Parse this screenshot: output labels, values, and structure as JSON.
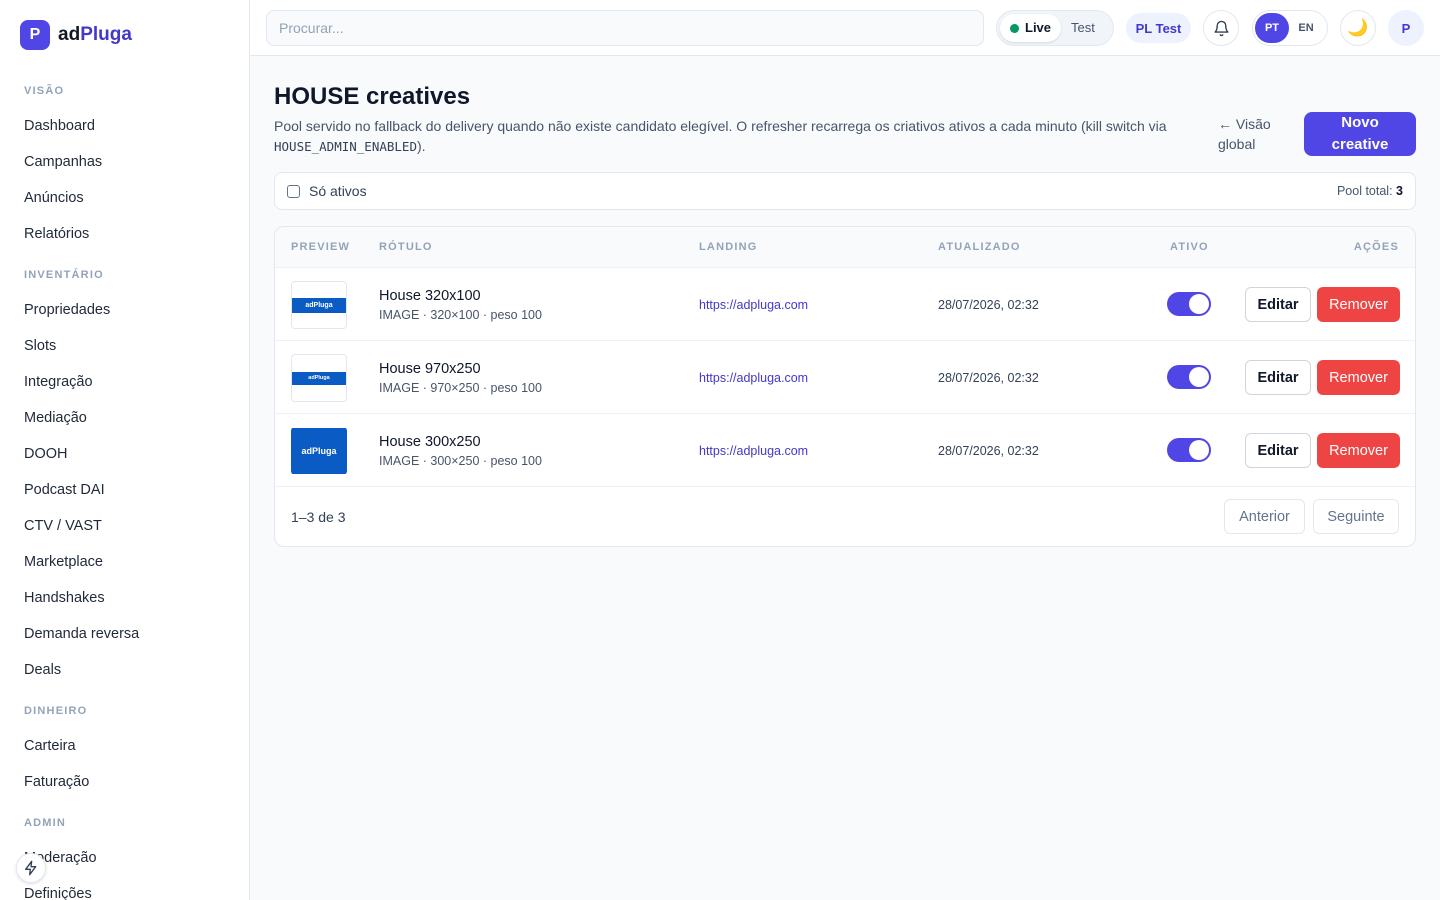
{
  "brand": {
    "logo_letter": "P",
    "name_prefix": "ad",
    "name_suffix": "Pluga"
  },
  "sidebar": {
    "sections": [
      {
        "title": "VISÃO",
        "items": [
          "Dashboard",
          "Campanhas",
          "Anúncios",
          "Relatórios"
        ]
      },
      {
        "title": "INVENTÁRIO",
        "items": [
          "Propriedades",
          "Slots",
          "Integração",
          "Mediação",
          "DOOH",
          "Podcast DAI",
          "CTV / VAST",
          "Marketplace",
          "Handshakes",
          "Demanda reversa",
          "Deals"
        ]
      },
      {
        "title": "DINHEIRO",
        "items": [
          "Carteira",
          "Faturação"
        ]
      },
      {
        "title": "ADMIN",
        "items": [
          "Moderação",
          "Definições"
        ]
      }
    ]
  },
  "topbar": {
    "search_placeholder": "Procurar...",
    "mode": {
      "live": "Live",
      "test": "Test"
    },
    "tenant": "PL Test",
    "lang": {
      "pt": "PT",
      "en": "EN"
    },
    "theme_icon": "🌙",
    "avatar": "P"
  },
  "page": {
    "title": "HOUSE creatives",
    "description": "Pool servido no fallback do delivery quando não existe candidato elegível. O refresher recarrega os criativos ativos a cada minuto (kill switch via ",
    "description_code": "HOUSE_ADMIN_ENABLED",
    "description_end": ").",
    "back_link": "← Visão global",
    "new_button": "Novo creative"
  },
  "filter": {
    "only_active_label": "Só ativos",
    "pool_total_label": "Pool total:",
    "pool_total_value": "3"
  },
  "table": {
    "headers": {
      "preview": "PREVIEW",
      "label": "RÓTULO",
      "landing": "LANDING",
      "updated": "ATUALIZADO",
      "active": "ATIVO",
      "actions": "AÇÕES"
    },
    "rows": [
      {
        "banner_text": "adPluga",
        "label": "House 320x100",
        "sub": "IMAGE · 320×100 · peso 100",
        "landing": "https://adpluga.com",
        "updated": "28/07/2026, 02:32",
        "active": true
      },
      {
        "banner_text": "adPluga",
        "label": "House 970x250",
        "sub": "IMAGE · 970×250 · peso 100",
        "landing": "https://adpluga.com",
        "updated": "28/07/2026, 02:32",
        "active": true
      },
      {
        "banner_text": "adPluga",
        "label": "House 300x250",
        "sub": "IMAGE · 300×250 · peso 100",
        "landing": "https://adpluga.com",
        "updated": "28/07/2026, 02:32",
        "active": true
      }
    ],
    "edit_label": "Editar",
    "remove_label": "Remover",
    "range": "1–3 de 3",
    "prev_label": "Anterior",
    "next_label": "Seguinte"
  },
  "colors": {
    "accent": "#4f46e5",
    "danger": "#ef4444",
    "live": "#059669",
    "banner": "#0a5bc4"
  }
}
